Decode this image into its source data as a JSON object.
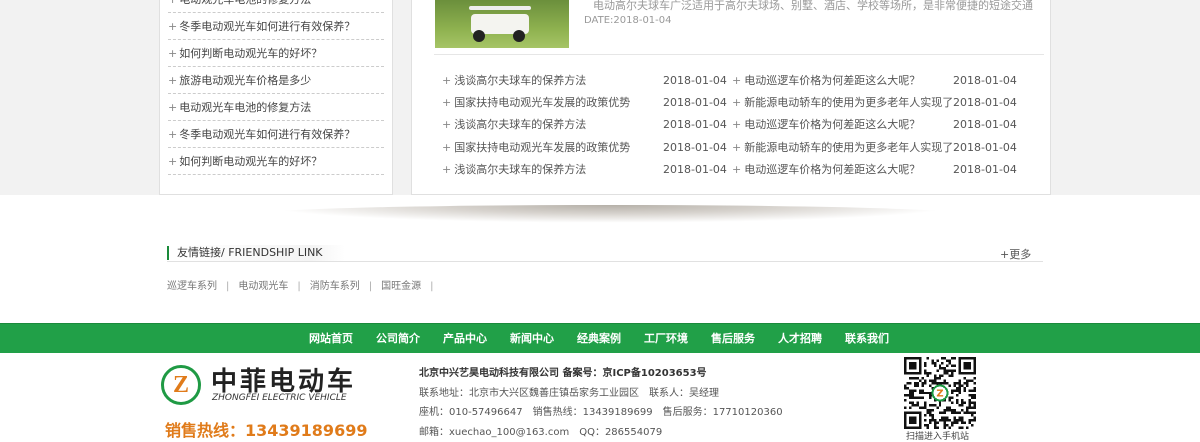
{
  "left_list": [
    "电动观光车电池的修复方法",
    "冬季电动观光车如何进行有效保养？",
    "如何判断电动观光车的好坏？",
    "旅游电动观光车价格是多少",
    "电动观光车电池的修复方法",
    "冬季电动观光车如何进行有效保养？",
    "如何判断电动观光车的好坏？"
  ],
  "featured": {
    "desc": "电动高尔夫球车广泛适用于高尔夫球场、别墅、酒店、学校等场所，是非常便捷的短途交通工具。",
    "date": "DATE:2018-01-04"
  },
  "news_left": [
    {
      "title": "浅谈高尔夫球车的保养方法",
      "date": "2018-01-04"
    },
    {
      "title": "国家扶持电动观光车发展的政策优势",
      "date": "2018-01-04"
    },
    {
      "title": "浅谈高尔夫球车的保养方法",
      "date": "2018-01-04"
    },
    {
      "title": "国家扶持电动观光车发展的政策优势",
      "date": "2018-01-04"
    },
    {
      "title": "浅谈高尔夫球车的保养方法",
      "date": "2018-01-04"
    }
  ],
  "news_right": [
    {
      "title": "电动巡逻车价格为何差距这么大呢？",
      "date": "2018-01-04"
    },
    {
      "title": "新能源电动轿车的使用为更多老年人实现了",
      "date": "2018-01-04"
    },
    {
      "title": "电动巡逻车价格为何差距这么大呢？",
      "date": "2018-01-04"
    },
    {
      "title": "新能源电动轿车的使用为更多老年人实现了",
      "date": "2018-01-04"
    },
    {
      "title": "电动巡逻车价格为何差距这么大呢？",
      "date": "2018-01-04"
    }
  ],
  "friend": {
    "title": "友情链接/ FRIENDSHIP LINK",
    "more": "+更多",
    "links": [
      "巡逻车系列",
      "电动观光车",
      "消防车系列",
      "国旺金源"
    ]
  },
  "nav": [
    "网站首页",
    "公司简介",
    "产品中心",
    "新闻中心",
    "经典案例",
    "工厂环境",
    "售后服务",
    "人才招聘",
    "联系我们"
  ],
  "footer": {
    "logo_cn": "中菲电动车",
    "logo_en": "ZHONGFEI ELECTRIC VEHICLE",
    "hotline": "销售热线：13439189699",
    "company": "北京中兴艺昊电动科技有限公司 备案号：京ICP备10203653号",
    "address": "联系地址：北京市大兴区魏善庄镇岳家务工业园区　联系人：吴经理",
    "phones": "座机：010-57496647　销售热线：13439189699　售后服务：17710120360",
    "contacts": "邮箱：xuechao_100@163.com　QQ：286554079",
    "qr_caption": "扫描进入手机站"
  },
  "colors": {
    "green": "#21a048",
    "orange": "#e07b1a"
  }
}
